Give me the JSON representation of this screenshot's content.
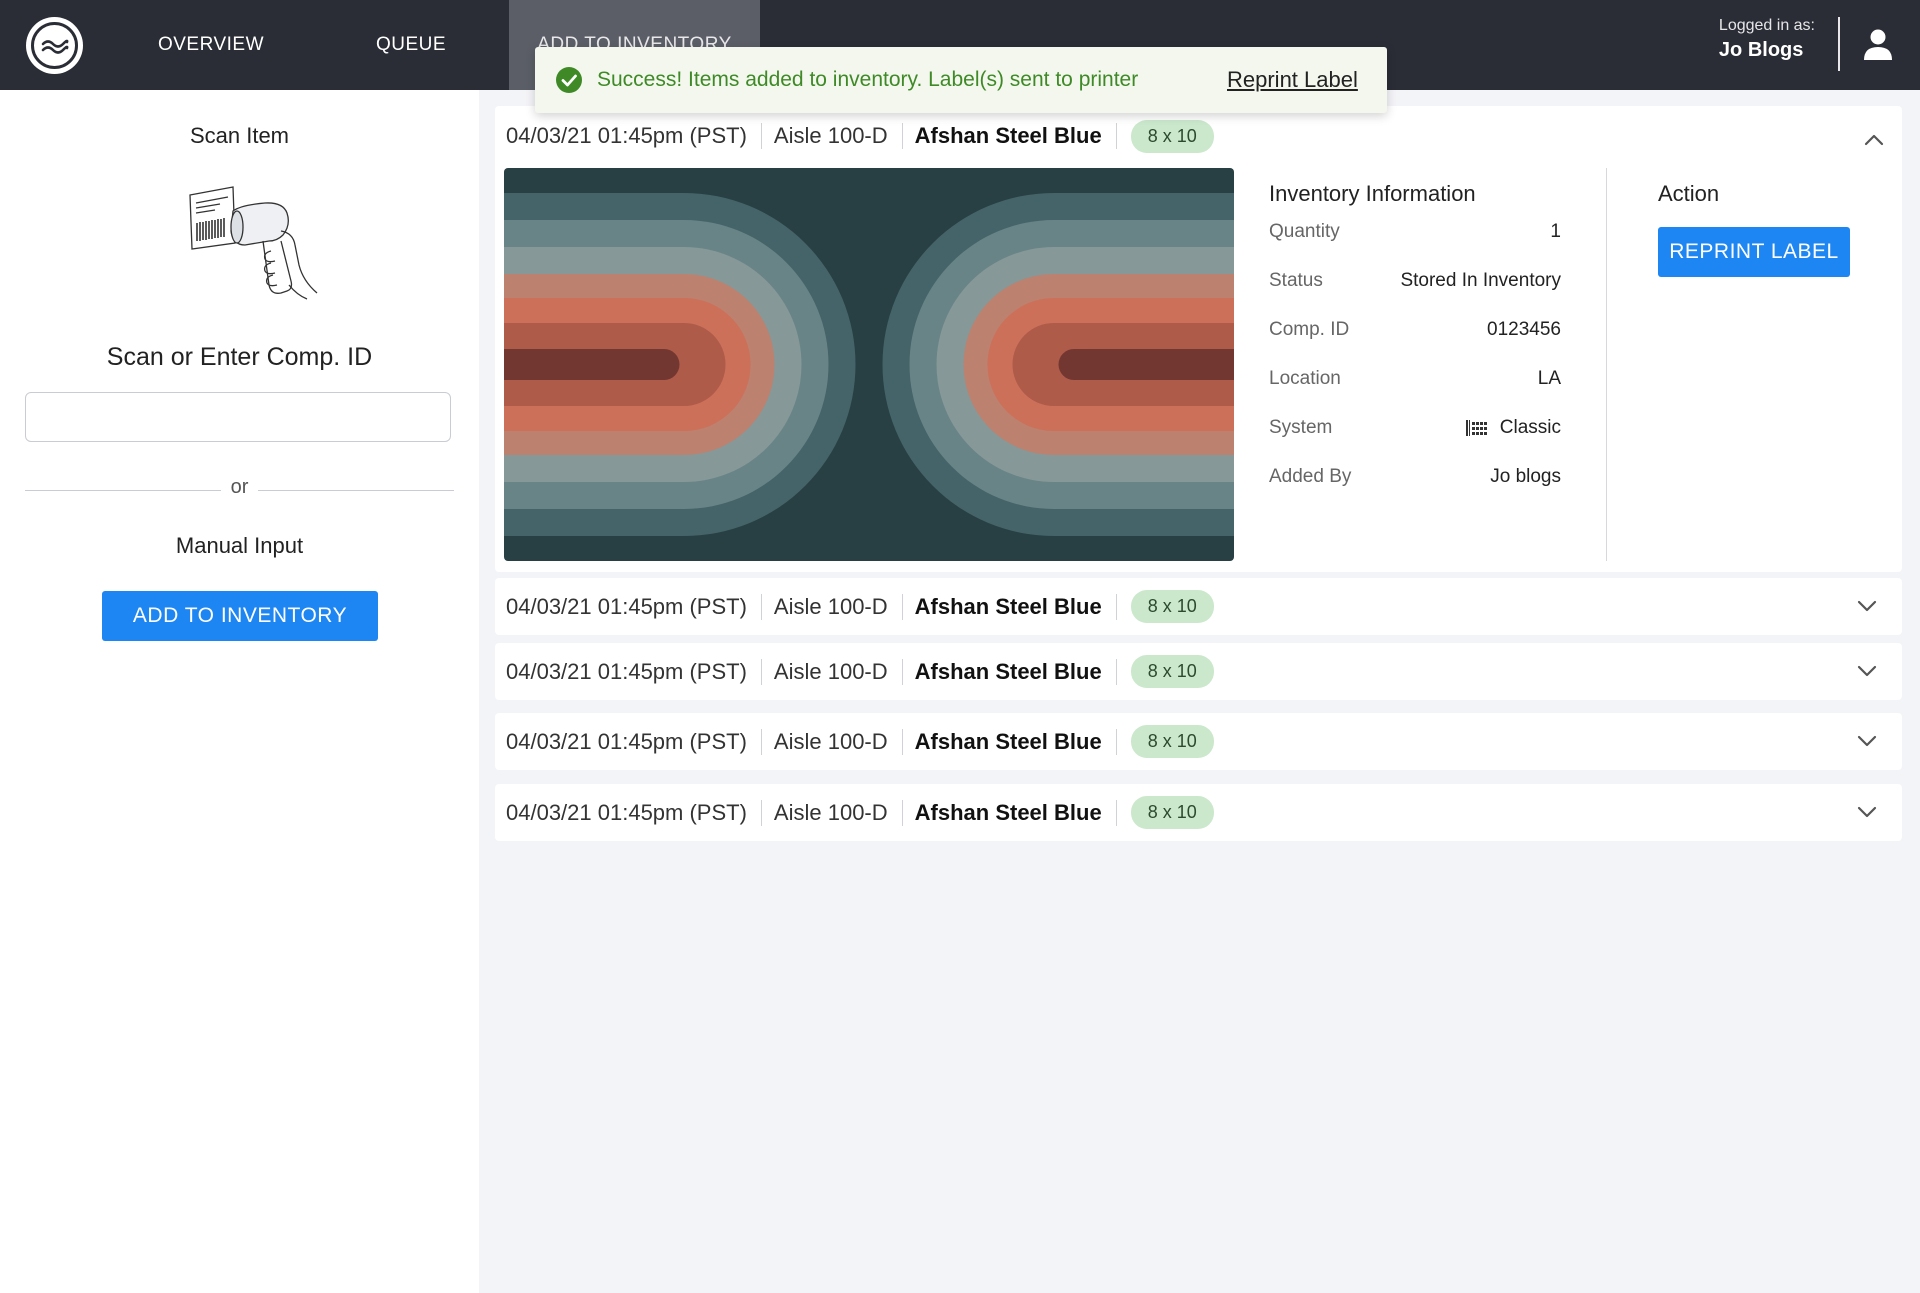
{
  "nav": {
    "items": [
      {
        "label": "OVERVIEW"
      },
      {
        "label": "QUEUE"
      },
      {
        "label": "ADD TO INVENTORY"
      }
    ],
    "logged_in_label": "Logged in as:",
    "user_name": "Jo Blogs"
  },
  "toast": {
    "message": "Success! Items added to inventory. Label(s) sent to printer",
    "link": "Reprint Label"
  },
  "left_panel": {
    "scan_title": "Scan Item",
    "scan_enter_label": "Scan or Enter Comp. ID",
    "comp_id_value": "",
    "or_text": "or",
    "manual_title": "Manual Input",
    "add_button": "ADD TO INVENTORY"
  },
  "rows": [
    {
      "timestamp": "04/03/21 01:45pm (PST)",
      "aisle": "Aisle 100-D",
      "name": "Afshan Steel Blue",
      "size": "8 x 10",
      "expanded": true
    },
    {
      "timestamp": "04/03/21 01:45pm (PST)",
      "aisle": "Aisle 100-D",
      "name": "Afshan Steel Blue",
      "size": "8 x 10",
      "expanded": false
    },
    {
      "timestamp": "04/03/21 01:45pm (PST)",
      "aisle": "Aisle 100-D",
      "name": "Afshan Steel Blue",
      "size": "8 x 10",
      "expanded": false
    },
    {
      "timestamp": "04/03/21 01:45pm (PST)",
      "aisle": "Aisle 100-D",
      "name": "Afshan Steel Blue",
      "size": "8 x 10",
      "expanded": false
    },
    {
      "timestamp": "04/03/21 01:45pm (PST)",
      "aisle": "Aisle 100-D",
      "name": "Afshan Steel Blue",
      "size": "8 x 10",
      "expanded": false
    }
  ],
  "inventory_info": {
    "title": "Inventory Information",
    "fields": [
      {
        "key": "Quantity",
        "value": "1"
      },
      {
        "key": "Status",
        "value": "Stored In Inventory"
      },
      {
        "key": "Comp. ID",
        "value": "0123456"
      },
      {
        "key": "Location",
        "value": "LA"
      },
      {
        "key": "System",
        "value": "Classic",
        "icon": "barcode-grid-icon"
      },
      {
        "key": "Added By",
        "value": "Jo blogs"
      }
    ]
  },
  "action": {
    "title": "Action",
    "button": "REPRINT LABEL"
  },
  "colors": {
    "nav_bg": "#2a2d36",
    "nav_active": "#5b5e67",
    "primary_button": "#1e86f2",
    "success_text": "#3f8a27",
    "size_badge": "#cbe8cc"
  }
}
